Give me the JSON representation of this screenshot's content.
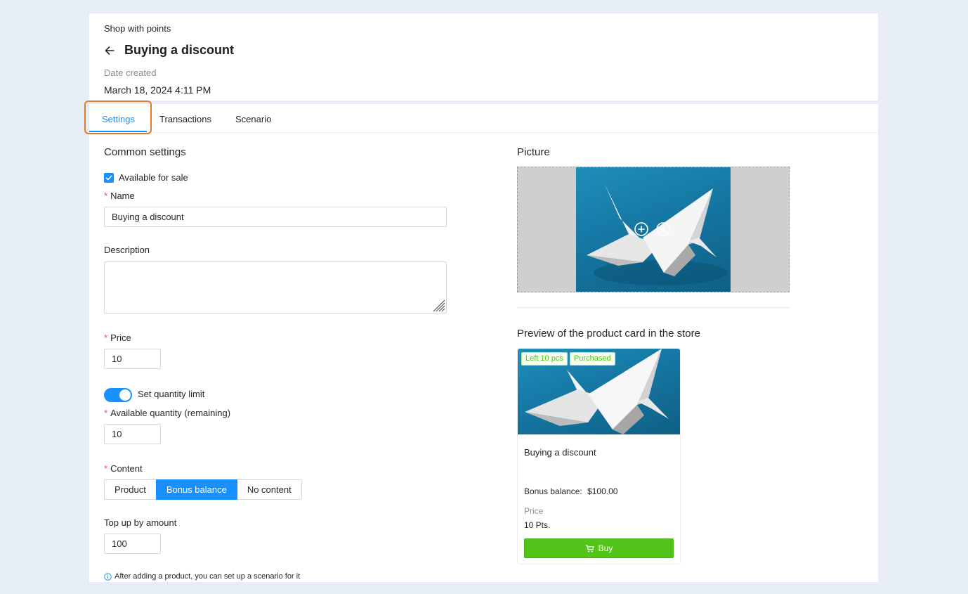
{
  "header": {
    "breadcrumb": "Shop with points",
    "title": "Buying a discount",
    "date_label": "Date created",
    "date_value": "March 18, 2024 4:11 PM"
  },
  "tabs": [
    {
      "label": "Settings",
      "active": true
    },
    {
      "label": "Transactions",
      "active": false
    },
    {
      "label": "Scenario",
      "active": false
    }
  ],
  "common_settings": {
    "title": "Common settings",
    "available_for_sale": {
      "label": "Available for sale",
      "checked": true
    },
    "name": {
      "label": "Name",
      "value": "Buying a discount"
    },
    "description": {
      "label": "Description",
      "value": ""
    },
    "price": {
      "label": "Price",
      "value": "10"
    },
    "quantity_limit": {
      "label": "Set quantity limit",
      "enabled": true
    },
    "available_quantity": {
      "label": "Available quantity (remaining)",
      "value": "10"
    },
    "content": {
      "label": "Content",
      "options": [
        "Product",
        "Bonus balance",
        "No content"
      ],
      "selected": "Bonus balance"
    },
    "top_up": {
      "label": "Top up by amount",
      "value": "100"
    },
    "info_note": "After adding a product, you can set up a scenario for it"
  },
  "picture": {
    "title": "Picture",
    "add_icon": "plus-circle-icon",
    "remove_icon": "close-circle-icon"
  },
  "preview": {
    "title": "Preview of the product card in the store",
    "tags": [
      "Left 10 pcs",
      "Purchased"
    ],
    "card_title": "Buying a discount",
    "bonus_label": "Bonus balance:",
    "bonus_value": "$100.00",
    "price_label": "Price",
    "price_value": "10 Pts.",
    "buy_label": "Buy"
  },
  "colors": {
    "accent": "#1890ff",
    "success": "#52c41a",
    "focus_outline": "#e07b2b",
    "required": "#ff4d4f"
  }
}
